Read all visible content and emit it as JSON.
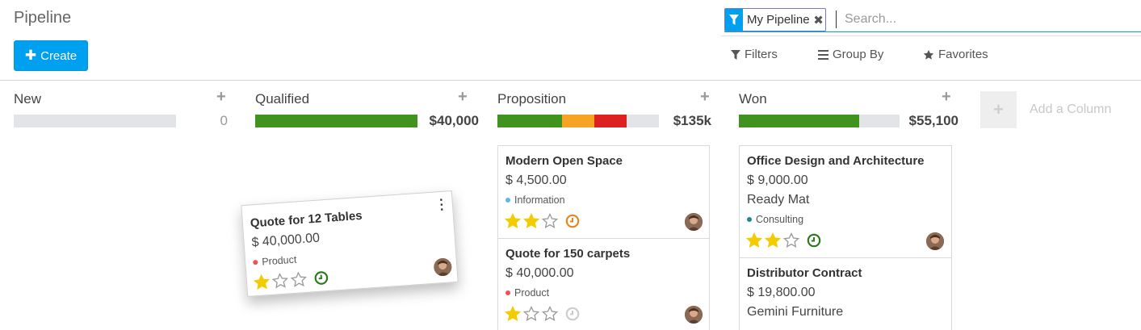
{
  "control_panel": {
    "title": "Pipeline",
    "create_label": "Create",
    "facet_label": "My Pipeline",
    "search_placeholder": "Search...",
    "filters_label": "Filters",
    "group_by_label": "Group By",
    "favorites_label": "Favorites"
  },
  "columns": [
    {
      "title": "New",
      "sum": "0"
    },
    {
      "title": "Qualified",
      "sum": "$40,000"
    },
    {
      "title": "Proposition",
      "sum": "$135k"
    },
    {
      "title": "Won",
      "sum": "$55,100"
    }
  ],
  "progress": {
    "new": [],
    "qualified": [
      {
        "color": "#41931f",
        "fraction": 1.0
      }
    ],
    "proposition": [
      {
        "color": "#41931f",
        "fraction": 0.4
      },
      {
        "color": "#f7a425",
        "fraction": 0.2
      },
      {
        "color": "#dd2020",
        "fraction": 0.2
      }
    ],
    "won": [
      {
        "color": "#41931f",
        "fraction": 0.75
      }
    ]
  },
  "add_column_label": "Add a Column",
  "dragged_card": {
    "name": "Quote for 12 Tables",
    "amount": "$ 40,000.00",
    "tag": "Product",
    "tag_color": "#ed5353",
    "stars": 1,
    "activity_color": "#2a7a1c"
  },
  "cards": {
    "modern_open_space": {
      "name": "Modern Open Space",
      "amount": "$ 4,500.00",
      "tag": "Information",
      "tag_color": "#5bb7e5",
      "stars": 2,
      "activity_color": "#e5881a"
    },
    "quote_150_carpets": {
      "name": "Quote for 150 carpets",
      "amount": "$ 40,000.00",
      "tag": "Product",
      "tag_color": "#ed5353",
      "stars": 1,
      "activity_color": "#cccccc"
    },
    "office_design": {
      "name": "Office Design and Architecture",
      "amount": "$ 9,000.00",
      "company": "Ready Mat",
      "tag": "Consulting",
      "tag_color": "#1e8a8a",
      "stars": 2,
      "activity_color": "#2a7a1c"
    },
    "distributor_contract": {
      "name": "Distributor Contract",
      "amount": "$ 19,800.00",
      "company": "Gemini Furniture"
    }
  },
  "colors": {
    "primary": "#00a0f0",
    "star": "#f3cc00"
  }
}
